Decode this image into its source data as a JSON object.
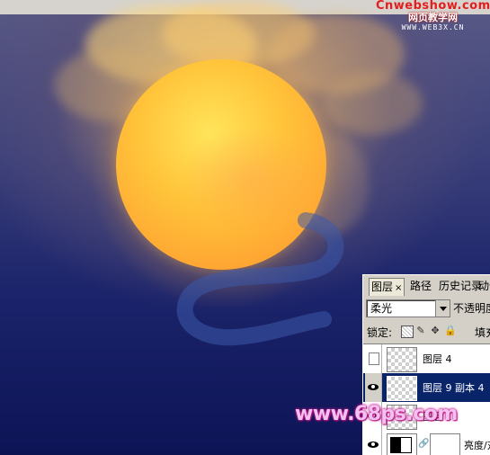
{
  "watermarks": {
    "top_site": "Cnwebshow.com",
    "top_cn": "网页教学网",
    "top_url": "WWW.WEB3X.CN",
    "bottom": "www.68ps.com"
  },
  "layers_panel": {
    "tabs": [
      {
        "label": "图层",
        "close": "×"
      },
      {
        "label": "路径"
      },
      {
        "label": "历史记录"
      },
      {
        "label": "动作"
      }
    ],
    "blend_mode": "柔光",
    "opacity_label": "不透明度:",
    "lock_label": "锁定:",
    "fill_label": "填充:",
    "layers": [
      {
        "name": "图层 4",
        "visible": false,
        "selected": false
      },
      {
        "name": "图层 9 副本 4",
        "visible": true,
        "selected": true
      },
      {
        "name": "图层 11",
        "visible": true,
        "selected": false
      },
      {
        "name": "亮度/对比度",
        "visible": true,
        "selected": false,
        "type": "adjustment"
      }
    ]
  },
  "colors": {
    "sun": "#ffc43a",
    "sky_bottom": "#0d1456",
    "selection": "#0a246a",
    "watermark_red": "#e21e1e",
    "watermark_pink": "#c8178d"
  }
}
